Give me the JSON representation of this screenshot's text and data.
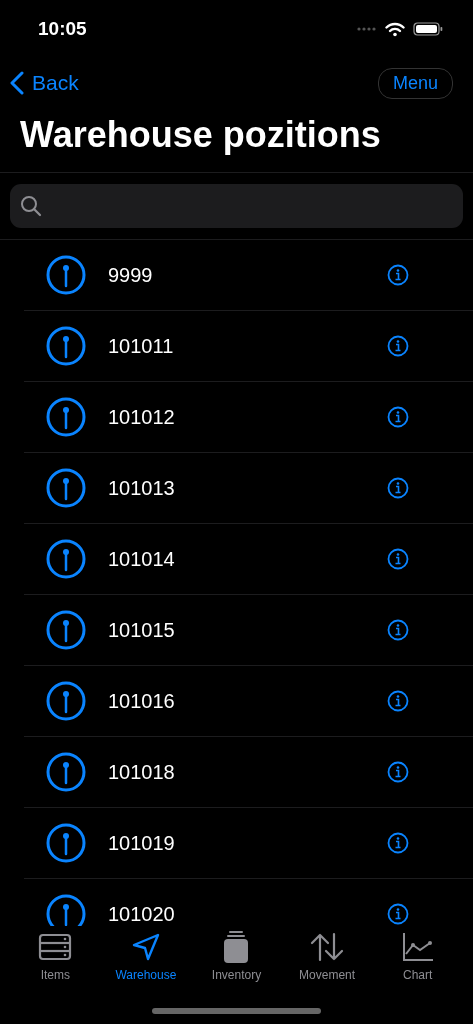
{
  "status_bar": {
    "time": "10:05"
  },
  "nav": {
    "back": "Back",
    "menu": "Menu"
  },
  "title": "Warehouse pozitions",
  "positions": [
    {
      "code": "9999"
    },
    {
      "code": "101011"
    },
    {
      "code": "101012"
    },
    {
      "code": "101013"
    },
    {
      "code": "101014"
    },
    {
      "code": "101015"
    },
    {
      "code": "101016"
    },
    {
      "code": "101018"
    },
    {
      "code": "101019"
    },
    {
      "code": "101020"
    }
  ],
  "tabs": [
    {
      "label": "Items",
      "kind": "items",
      "selected": false
    },
    {
      "label": "Warehouse",
      "kind": "warehouse",
      "selected": true
    },
    {
      "label": "Inventory",
      "kind": "inventory",
      "selected": false
    },
    {
      "label": "Movement",
      "kind": "movement",
      "selected": false
    },
    {
      "label": "Chart",
      "kind": "chart",
      "selected": false
    }
  ]
}
